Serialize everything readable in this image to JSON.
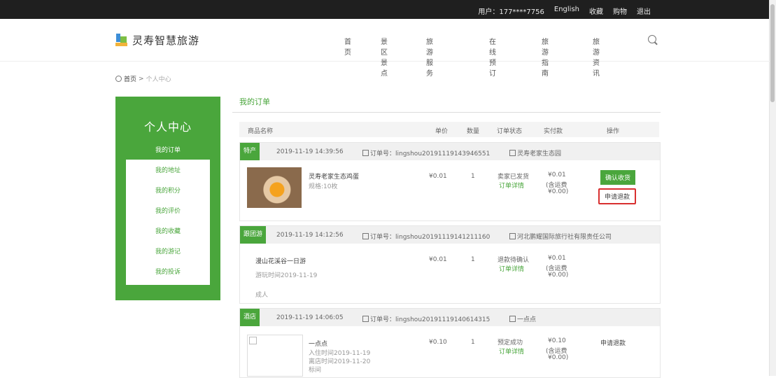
{
  "topbar": {
    "account": "用户：177****7756",
    "lang": "English",
    "links": [
      "收藏",
      "购物",
      "退出"
    ]
  },
  "header": {
    "logo_text": "灵寿智慧旅游",
    "nav": [
      "首页",
      "景区景点",
      "旅游服务",
      "在线预订",
      "旅游指南",
      "旅游资讯"
    ]
  },
  "breadcrumb": {
    "home": "首页",
    "sep": ">",
    "current": "个人中心"
  },
  "sidebar": {
    "title": "个人中心",
    "items": [
      "我的订单",
      "我的地址",
      "我的积分",
      "我的评价",
      "我的收藏",
      "我的游记",
      "我的投诉"
    ]
  },
  "main": {
    "title": "我的订单",
    "columns": [
      "商品名称",
      "单价",
      "数量",
      "订单状态",
      "实付款",
      "操作"
    ]
  },
  "orders": [
    {
      "type": "特产",
      "time": "2019-11-19 14:39:56",
      "order_no": "订单号：lingshou20191119143946551",
      "shop": "灵寿老家生态园",
      "item_name": "灵寿老家生态鸡蛋",
      "item_sub": "规格:10枚",
      "price": "¥0.01",
      "qty": "1",
      "status": "卖家已发货",
      "detail": "订单详情",
      "pay": "¥0.01",
      "pay_note": "(含运费",
      "pay_fee": "¥0.00)",
      "op_primary": "确认收货",
      "op_secondary": "申请退款"
    },
    {
      "type": "跟团游",
      "time": "2019-11-19 14:12:56",
      "order_no": "订单号：lingshou20191119141211160",
      "shop": "河北鹏耀国际旅行社有限责任公司",
      "item_name": "漫山花溪谷一日游",
      "item_sub": "游玩时间2019-11-19",
      "item_extra": "成人",
      "price": "¥0.01",
      "qty": "1",
      "status": "退款待确认",
      "detail": "订单详情",
      "pay": "¥0.01",
      "pay_note": "(含运费",
      "pay_fee": "¥0.00)"
    },
    {
      "type": "酒店",
      "time": "2019-11-19 14:06:05",
      "order_no": "订单号：lingshou20191119140614315",
      "shop": "一点点",
      "item_name": "一点点",
      "item_sub": "入住时间2019-11-19",
      "item_sub2": "离店时间2019-11-20",
      "item_extra": "标间",
      "price": "¥0.10",
      "qty": "1",
      "status": "预定成功",
      "detail": "订单详情",
      "pay": "¥0.10",
      "pay_note": "(含运费",
      "pay_fee": "¥0.00)",
      "op_secondary": "申请退款"
    }
  ]
}
